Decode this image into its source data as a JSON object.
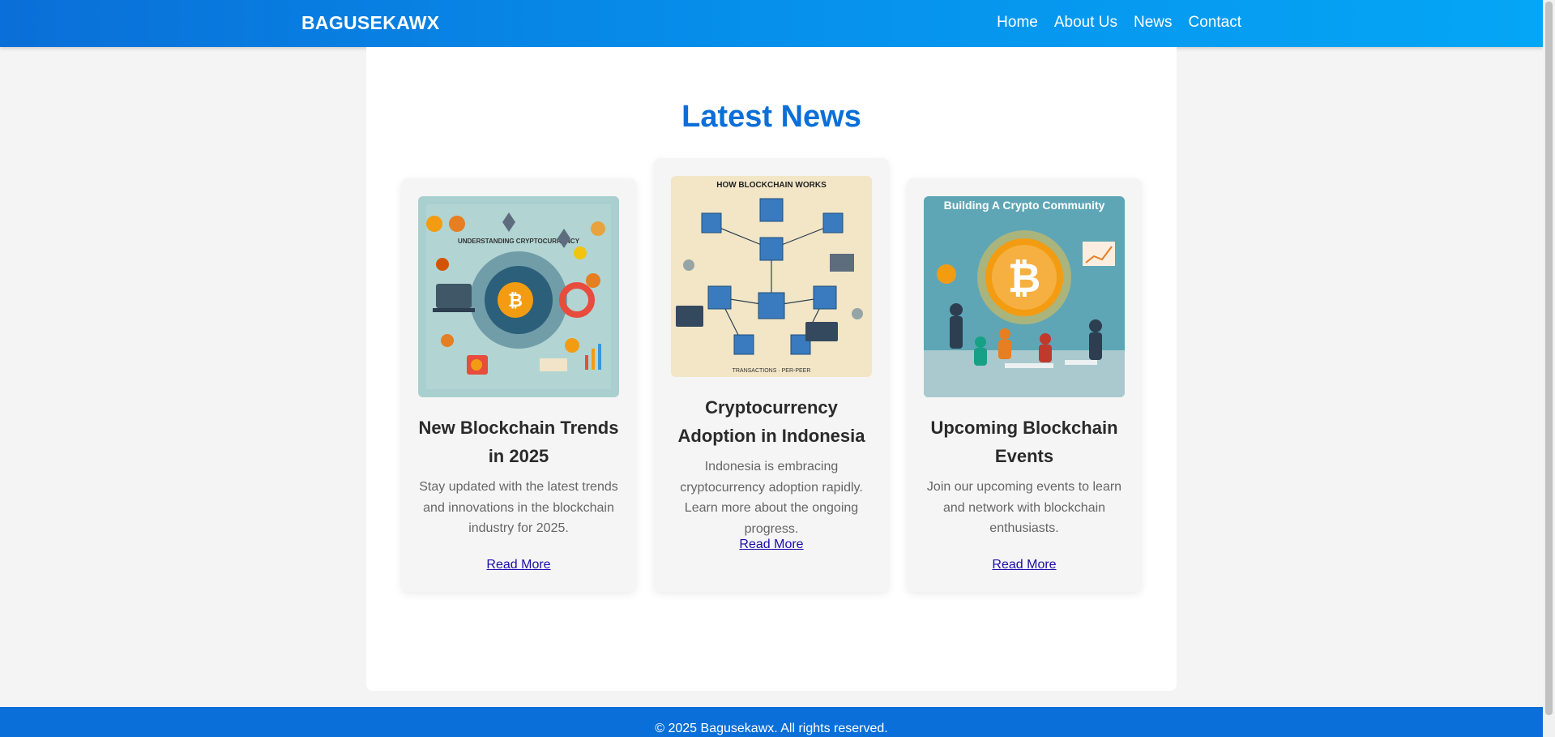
{
  "brand": "BAGUSEKAWX",
  "nav": [
    "Home",
    "About Us",
    "News",
    "Contact"
  ],
  "section_title": "Latest News",
  "cards": [
    {
      "title": "New Blockchain Trends in 2025",
      "text": "Stay updated with the latest trends and innovations in the blockchain industry for 2025.",
      "link": "Read More",
      "image_caption": "UNDERSTANDING CRYPTOCURRENCY"
    },
    {
      "title": "Cryptocurrency Adoption in Indonesia",
      "text": "Indonesia is embracing cryptocurrency adoption rapidly. Learn more about the ongoing progress.",
      "link": "Read More",
      "image_caption": "HOW BLOCKCHAIN WORKS"
    },
    {
      "title": "Upcoming Blockchain Events",
      "text": "Join our upcoming events to learn and network with blockchain enthusiasts.",
      "link": "Read More",
      "image_caption": "Building A Crypto Community"
    }
  ],
  "footer": "© 2025 Bagusekawx. All rights reserved.",
  "colors": {
    "primary": "#0a6fd8",
    "nav_gradient_end": "#05a6f5",
    "link": "#1a0dab",
    "bitcoin_orange": "#f39c12"
  }
}
